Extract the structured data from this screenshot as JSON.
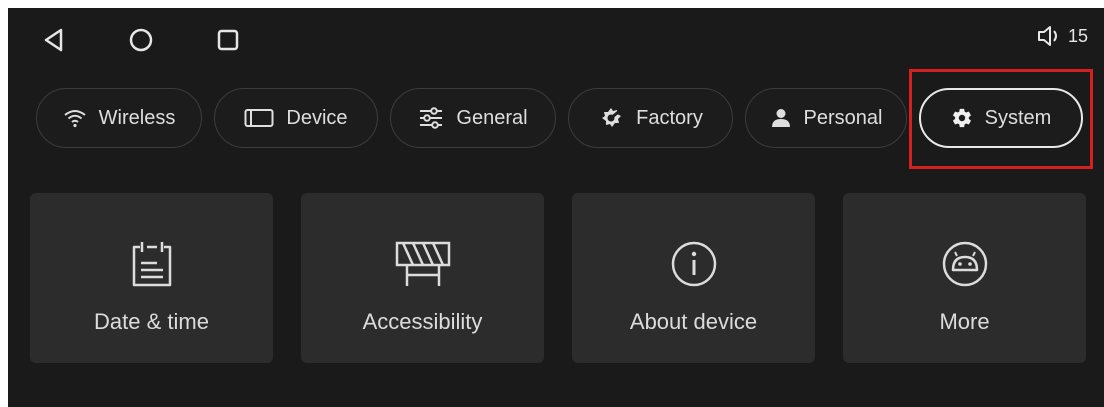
{
  "statusbar": {
    "nav": {
      "back_icon": "back-triangle-icon",
      "home_icon": "home-circle-icon",
      "recents_icon": "recents-square-icon"
    },
    "volume": {
      "icon": "speaker-icon",
      "level": "15"
    }
  },
  "tabs": [
    {
      "label": "Wireless",
      "icon": "wifi-icon",
      "active": false
    },
    {
      "label": "Device",
      "icon": "device-screen-icon",
      "active": false
    },
    {
      "label": "General",
      "icon": "sliders-icon",
      "active": false
    },
    {
      "label": "Factory",
      "icon": "factory-gear-icon",
      "active": false
    },
    {
      "label": "Personal",
      "icon": "person-icon",
      "active": false
    },
    {
      "label": "System",
      "icon": "gear-icon",
      "active": true
    }
  ],
  "cards": [
    {
      "label": "Date & time",
      "icon": "calendar-icon"
    },
    {
      "label": "Accessibility",
      "icon": "barrier-icon"
    },
    {
      "label": "About device",
      "icon": "info-icon"
    },
    {
      "label": "More",
      "icon": "android-icon"
    }
  ],
  "colors": {
    "background": "#1a1a1a",
    "card": "#2c2c2c",
    "text": "#dcdcdc",
    "highlight": "#d61f1f",
    "active_border": "#e8e8e8"
  }
}
